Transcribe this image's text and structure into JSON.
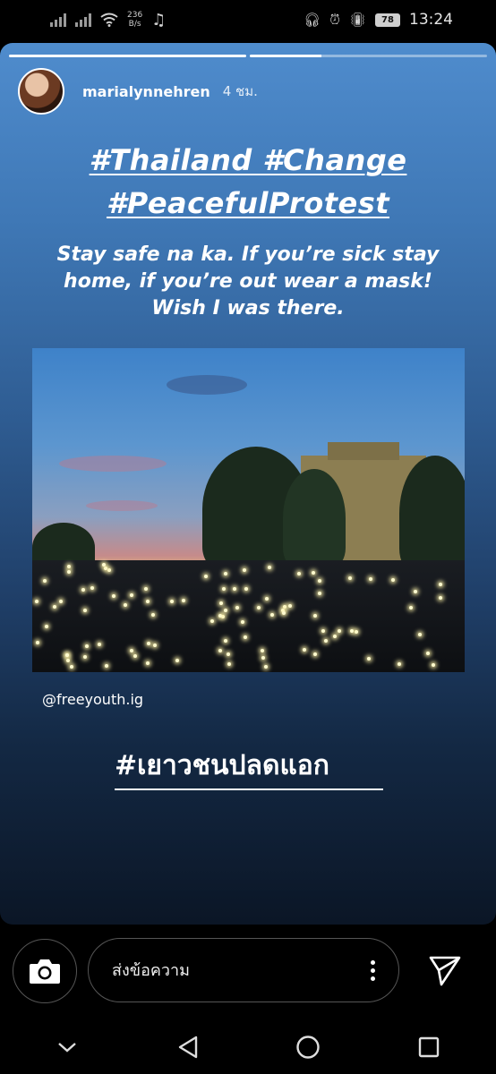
{
  "status_bar": {
    "network_speed_value": "236",
    "network_speed_unit": "B/s",
    "battery": "78",
    "time": "13:24"
  },
  "story": {
    "progress": [
      1.0,
      0.3
    ],
    "username": "marialynnehren",
    "age": "4 ชม.",
    "hashtag_line1": "#Thailand #Change",
    "hashtag_line2": "#PeacefulProtest",
    "caption": "Stay safe na ka. If you’re sick stay home, if you’re out wear a mask! Wish I was there.",
    "photo_credit": "@freeyouth.ig",
    "thai_hashtag": "#เยาวชนปลดแอก"
  },
  "reply_bar": {
    "placeholder": "ส่งข้อความ"
  },
  "icons": {
    "camera": "camera-icon",
    "more": "more-vertical-icon",
    "send": "send-icon",
    "nav_down": "chevron-down-icon",
    "nav_back": "back-triangle-icon",
    "nav_home": "home-circle-icon",
    "nav_recent": "recent-square-icon"
  }
}
